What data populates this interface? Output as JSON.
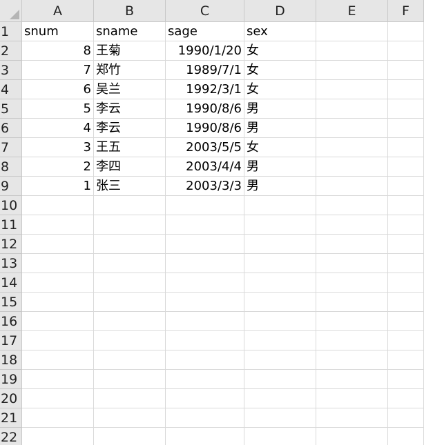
{
  "columns": [
    "A",
    "B",
    "C",
    "D",
    "E",
    "F"
  ],
  "row_numbers": [
    "1",
    "2",
    "3",
    "4",
    "5",
    "6",
    "7",
    "8",
    "9",
    "10",
    "11",
    "12",
    "13",
    "14",
    "15",
    "16",
    "17",
    "18",
    "19",
    "20",
    "21",
    "22"
  ],
  "rows": [
    [
      "snum",
      "sname",
      "sage",
      "sex",
      "",
      ""
    ],
    [
      "8",
      "王菊",
      "1990/1/20",
      "女",
      "",
      ""
    ],
    [
      "7",
      "郑竹",
      "1989/7/1",
      "女",
      "",
      ""
    ],
    [
      "6",
      "吴兰",
      "1992/3/1",
      "女",
      "",
      ""
    ],
    [
      "5",
      "李云",
      "1990/8/6",
      "男",
      "",
      ""
    ],
    [
      "4",
      "李云",
      "1990/8/6",
      "男",
      "",
      ""
    ],
    [
      "3",
      "王五",
      "2003/5/5",
      "女",
      "",
      ""
    ],
    [
      "2",
      "李四",
      "2003/4/4",
      "男",
      "",
      ""
    ],
    [
      "1",
      "张三",
      "2003/3/3",
      "男",
      "",
      ""
    ]
  ],
  "colors": {
    "header_bg": "#e6e6e6",
    "gridline": "#d9d9d9"
  }
}
